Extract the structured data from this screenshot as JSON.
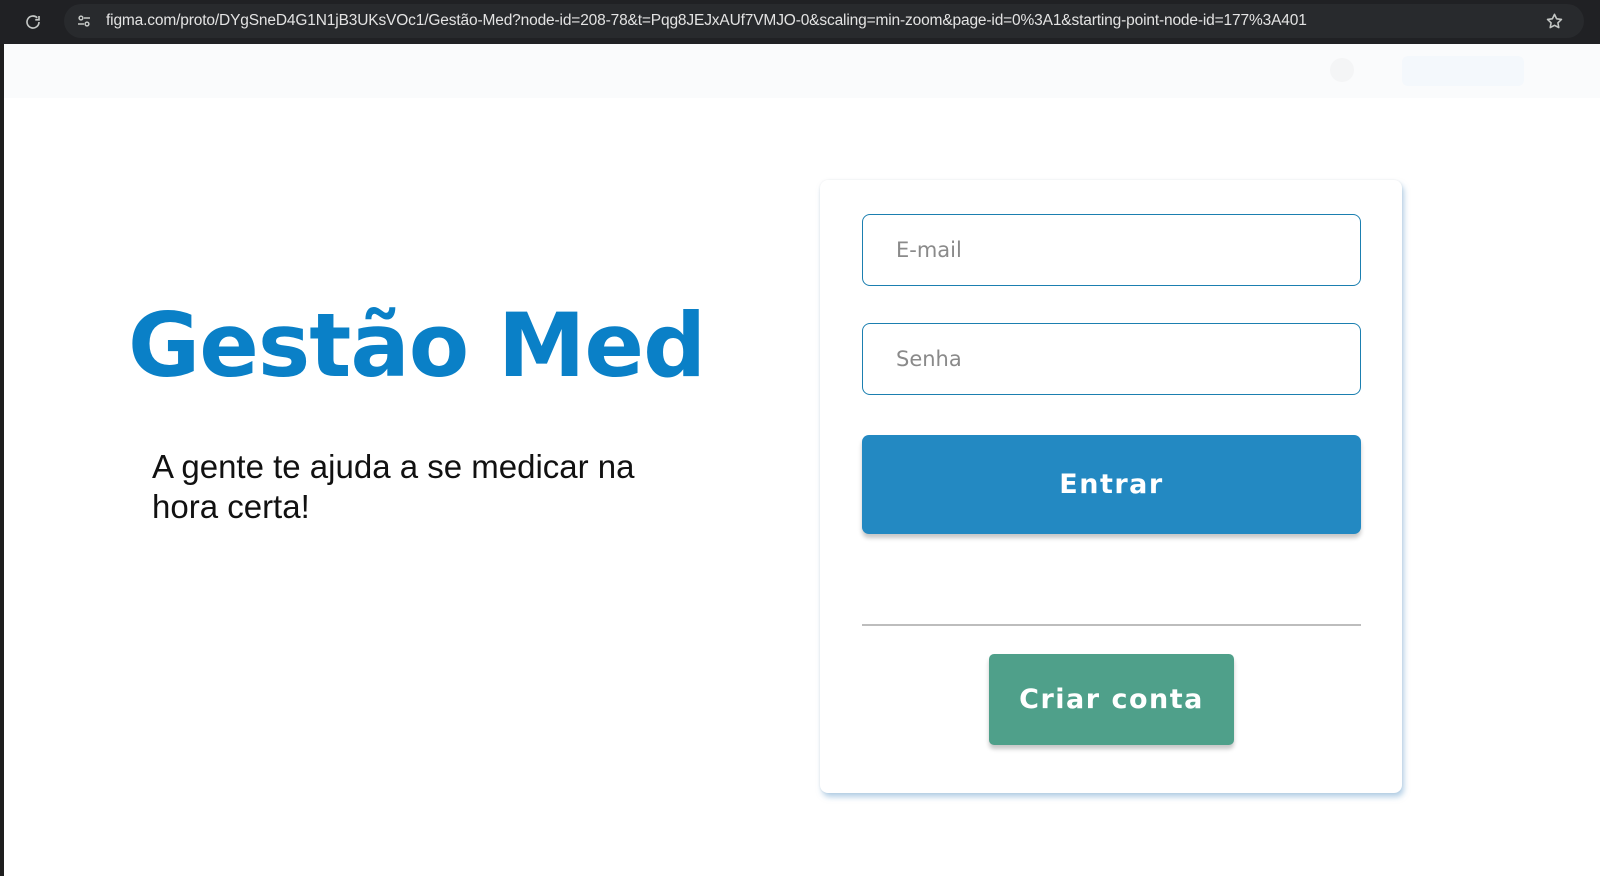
{
  "browser": {
    "url": "figma.com/proto/DYgSneD4G1N1jB3UKsVOc1/Gestão-Med?node-id=208-78&t=Pqg8JEJxAUf7VMJO-0&scaling=min-zoom&page-id=0%3A1&starting-point-node-id=177%3A401",
    "icons": [
      "reload-icon",
      "site-info-icon",
      "bookmark-star-icon"
    ]
  },
  "brand": {
    "title": "Gestão Med",
    "tagline": "A gente te ajuda a se medicar na hora certa!"
  },
  "login": {
    "email_placeholder": "E-mail",
    "password_placeholder": "Senha",
    "enter_label": "Entrar",
    "create_account_label": "Criar conta"
  },
  "colors": {
    "brand_blue": "#0a80c7",
    "enter_button": "#2389c2",
    "create_button": "#4fa08a",
    "field_border": "#1b7fb0"
  }
}
